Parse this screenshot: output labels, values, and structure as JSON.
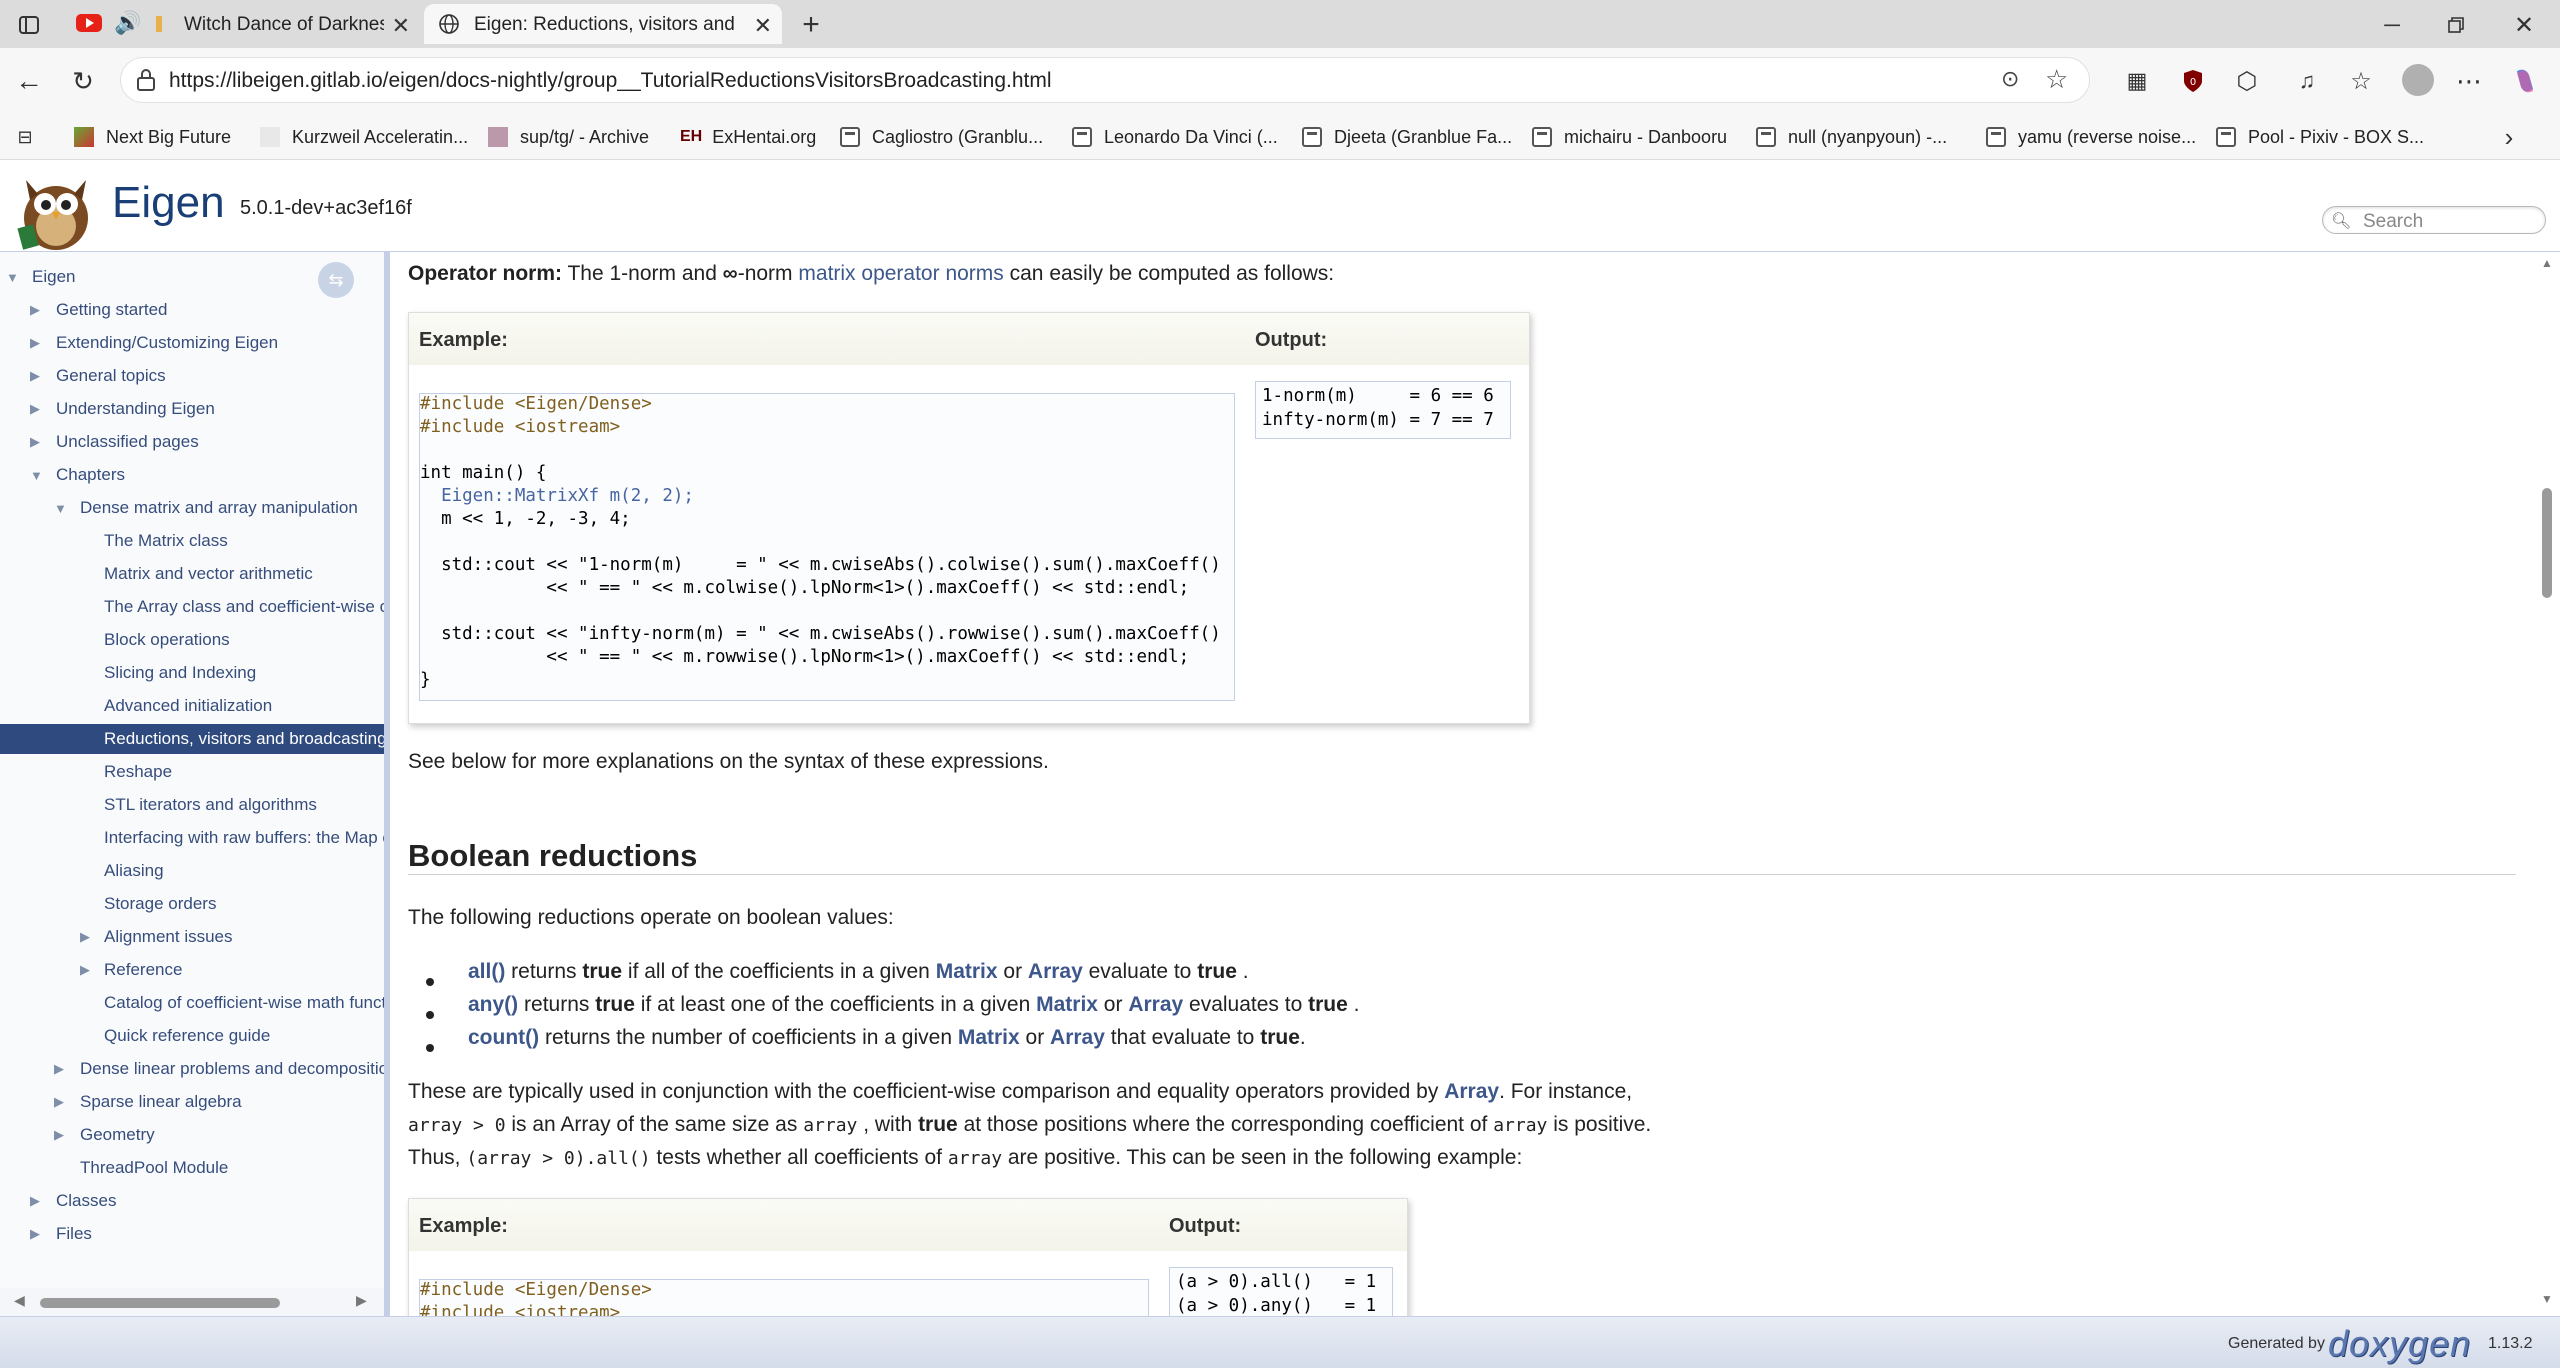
{
  "browser": {
    "tabs": [
      {
        "title": "Witch Dance of Darkness"
      },
      {
        "title": "Eigen: Reductions, visitors and broadcasting"
      }
    ],
    "new_tab": "+",
    "url": "https://libeigen.gitlab.io/eigen/docs-nightly/group__TutorialReductionsVisitorsBroadcasting.html",
    "bookmarks": [
      {
        "label": "Next Big Future"
      },
      {
        "label": "Kurzweil Acceleratin..."
      },
      {
        "label": "sup/tg/ - Archive"
      },
      {
        "label": "ExHentai.org"
      },
      {
        "label": "Cagliostro (Granblu..."
      },
      {
        "label": "Leonardo Da Vinci (..."
      },
      {
        "label": "Djeeta (Granblue Fa..."
      },
      {
        "label": "michairu - Danbooru"
      },
      {
        "label": "null (nyanpyoun) -..."
      },
      {
        "label": "yamu (reverse noise..."
      },
      {
        "label": "Pool - Pixiv - BOX S..."
      }
    ]
  },
  "header": {
    "project_name": "Eigen",
    "project_version": "5.0.1-dev+ac3ef16f",
    "search_placeholder": "Search"
  },
  "nav": {
    "items": [
      {
        "label": "Eigen"
      },
      {
        "label": "Getting started"
      },
      {
        "label": "Extending/Customizing Eigen"
      },
      {
        "label": "General topics"
      },
      {
        "label": "Understanding Eigen"
      },
      {
        "label": "Unclassified pages"
      },
      {
        "label": "Chapters"
      },
      {
        "label": "Dense matrix and array manipulation"
      },
      {
        "label": "The Matrix class"
      },
      {
        "label": "Matrix and vector arithmetic"
      },
      {
        "label": "The Array class and coefficient-wise operations"
      },
      {
        "label": "Block operations"
      },
      {
        "label": "Slicing and Indexing"
      },
      {
        "label": "Advanced initialization"
      },
      {
        "label": "Reductions, visitors and broadcasting"
      },
      {
        "label": "Reshape"
      },
      {
        "label": "STL iterators and algorithms"
      },
      {
        "label": "Interfacing with raw buffers: the Map class"
      },
      {
        "label": "Aliasing"
      },
      {
        "label": "Storage orders"
      },
      {
        "label": "Alignment issues"
      },
      {
        "label": "Reference"
      },
      {
        "label": "Catalog of coefficient-wise math functions"
      },
      {
        "label": "Quick reference guide"
      },
      {
        "label": "Dense linear problems and decompositions"
      },
      {
        "label": "Sparse linear algebra"
      },
      {
        "label": "Geometry"
      },
      {
        "label": "ThreadPool Module"
      },
      {
        "label": "Classes"
      },
      {
        "label": "Files"
      }
    ]
  },
  "content": {
    "opnorm": {
      "bold": "Operator norm:",
      "t1": " The 1-norm and ",
      "inf": "∞",
      "t2": "-norm ",
      "link": "matrix operator norms",
      "t3": " can easily be computed as follows:"
    },
    "example_label": "Example:",
    "output_label": "Output:",
    "code1": [
      "#include <Eigen/Dense>",
      "#include <iostream>",
      "",
      "int main() {",
      "  Eigen::MatrixXf m(2, 2);",
      "  m << 1, -2, -3, 4;",
      "",
      "  std::cout << \"1-norm(m)     = \" << m.cwiseAbs().colwise().sum().maxCoeff()",
      "            << \" == \" << m.colwise().lpNorm<1>().maxCoeff() << std::endl;",
      "",
      "  std::cout << \"infty-norm(m) = \" << m.cwiseAbs().rowwise().sum().maxCoeff()",
      "            << \" == \" << m.rowwise().lpNorm<1>().maxCoeff() << std::endl;",
      "}"
    ],
    "output1": [
      "1-norm(m)     = 6 == 6",
      "infty-norm(m) = 7 == 7"
    ],
    "see_below": "See below for more explanations on the syntax of these expressions.",
    "bool_heading": "Boolean reductions",
    "bool_intro": "The following reductions operate on boolean values:",
    "bullets": [
      {
        "fn": "all()",
        "a": " returns ",
        "b1": "true",
        "c": " if all of the coefficients in a given ",
        "m": "Matrix",
        "or": " or ",
        "arr": "Array",
        "d": " evaluate to ",
        "b2": "true",
        "e": " ."
      },
      {
        "fn": "any()",
        "a": " returns ",
        "b1": "true",
        "c": " if at least one of the coefficients in a given ",
        "m": "Matrix",
        "or": " or ",
        "arr": "Array",
        "d": " evaluates to ",
        "b2": "true",
        "e": " ."
      },
      {
        "fn": "count()",
        "a": " returns the number of coefficients in a given ",
        "m": "Matrix",
        "or": " or ",
        "arr": "Array",
        "d": " that evaluate to ",
        "b2": "true",
        "e": "."
      }
    ],
    "para": {
      "l1a": "These are typically used in conjunction with the coefficient-wise comparison and equality operators provided by ",
      "l1link": "Array",
      "l1b": ". For instance,",
      "l2code1": "array > 0",
      "l2a": " is an Array of the same size as ",
      "l2code2": "array",
      "l2b": " , with ",
      "l2bold": "true",
      "l2c": " at those positions where the corresponding coefficient of ",
      "l2code3": "array",
      "l2d": " is positive.",
      "l3a": "Thus, ",
      "l3code": "(array > 0).all()",
      "l3b": " tests whether all coefficients of ",
      "l3code2": "array",
      "l3c": " are positive. This can be seen in the following example:"
    },
    "code2": [
      "#include <Eigen/Dense>",
      "#include <iostream>"
    ],
    "output2": [
      "(a > 0).all()   = 1",
      "(a > 0).any()   = 1"
    ]
  },
  "footer": {
    "generated_by": "Generated by",
    "doxygen": "doxygen",
    "version": "1.13.2"
  }
}
